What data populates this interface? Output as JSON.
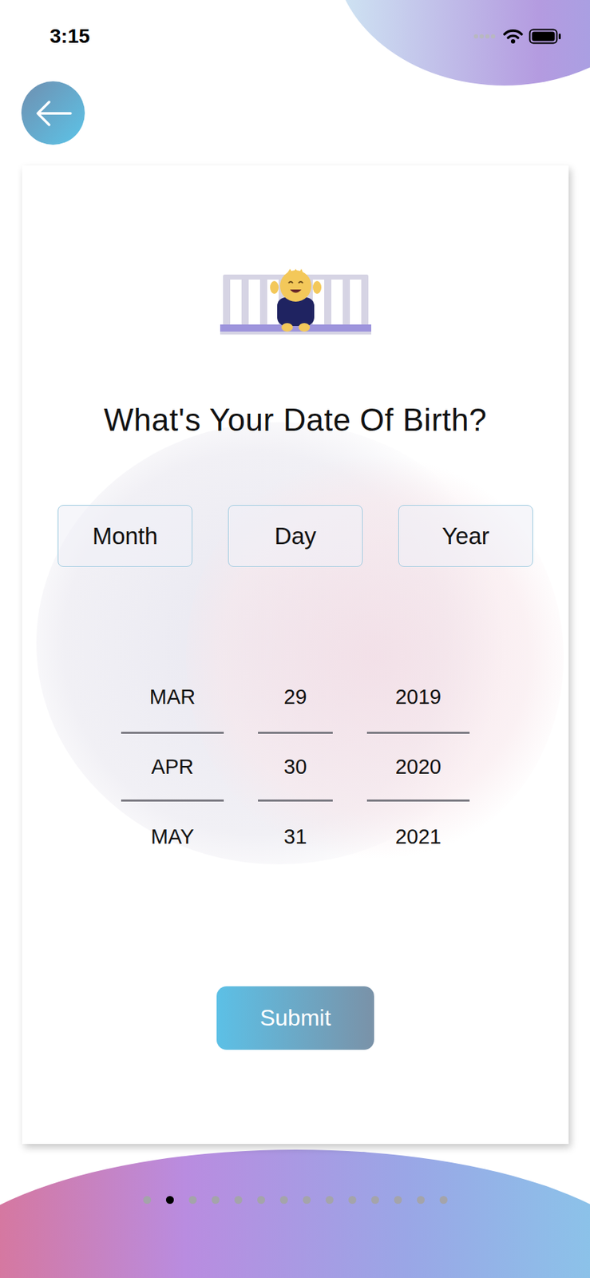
{
  "status_bar": {
    "time": "3:15"
  },
  "title": "What's Your Date Of Birth?",
  "fields": [
    {
      "label": "Month"
    },
    {
      "label": "Day"
    },
    {
      "label": "Year"
    }
  ],
  "picker": {
    "columns": [
      {
        "items": [
          {
            "label": "MAR",
            "selected": false
          },
          {
            "label": "APR",
            "selected": true
          },
          {
            "label": "MAY",
            "selected": false
          }
        ]
      },
      {
        "items": [
          {
            "label": "29",
            "selected": false
          },
          {
            "label": "30",
            "selected": true
          },
          {
            "label": "31",
            "selected": false
          }
        ]
      },
      {
        "items": [
          {
            "label": "2019",
            "selected": false
          },
          {
            "label": "2020",
            "selected": true
          },
          {
            "label": "2021",
            "selected": false
          }
        ]
      }
    ]
  },
  "submit": "Submit",
  "pages": [
    {
      "selected": false
    },
    {
      "selected": true
    },
    {
      "selected": false
    },
    {
      "selected": false
    },
    {
      "selected": false
    },
    {
      "selected": false
    },
    {
      "selected": false
    },
    {
      "selected": false
    },
    {
      "selected": false
    },
    {
      "selected": false
    },
    {
      "selected": false
    },
    {
      "selected": false
    },
    {
      "selected": false
    },
    {
      "selected": false
    }
  ]
}
